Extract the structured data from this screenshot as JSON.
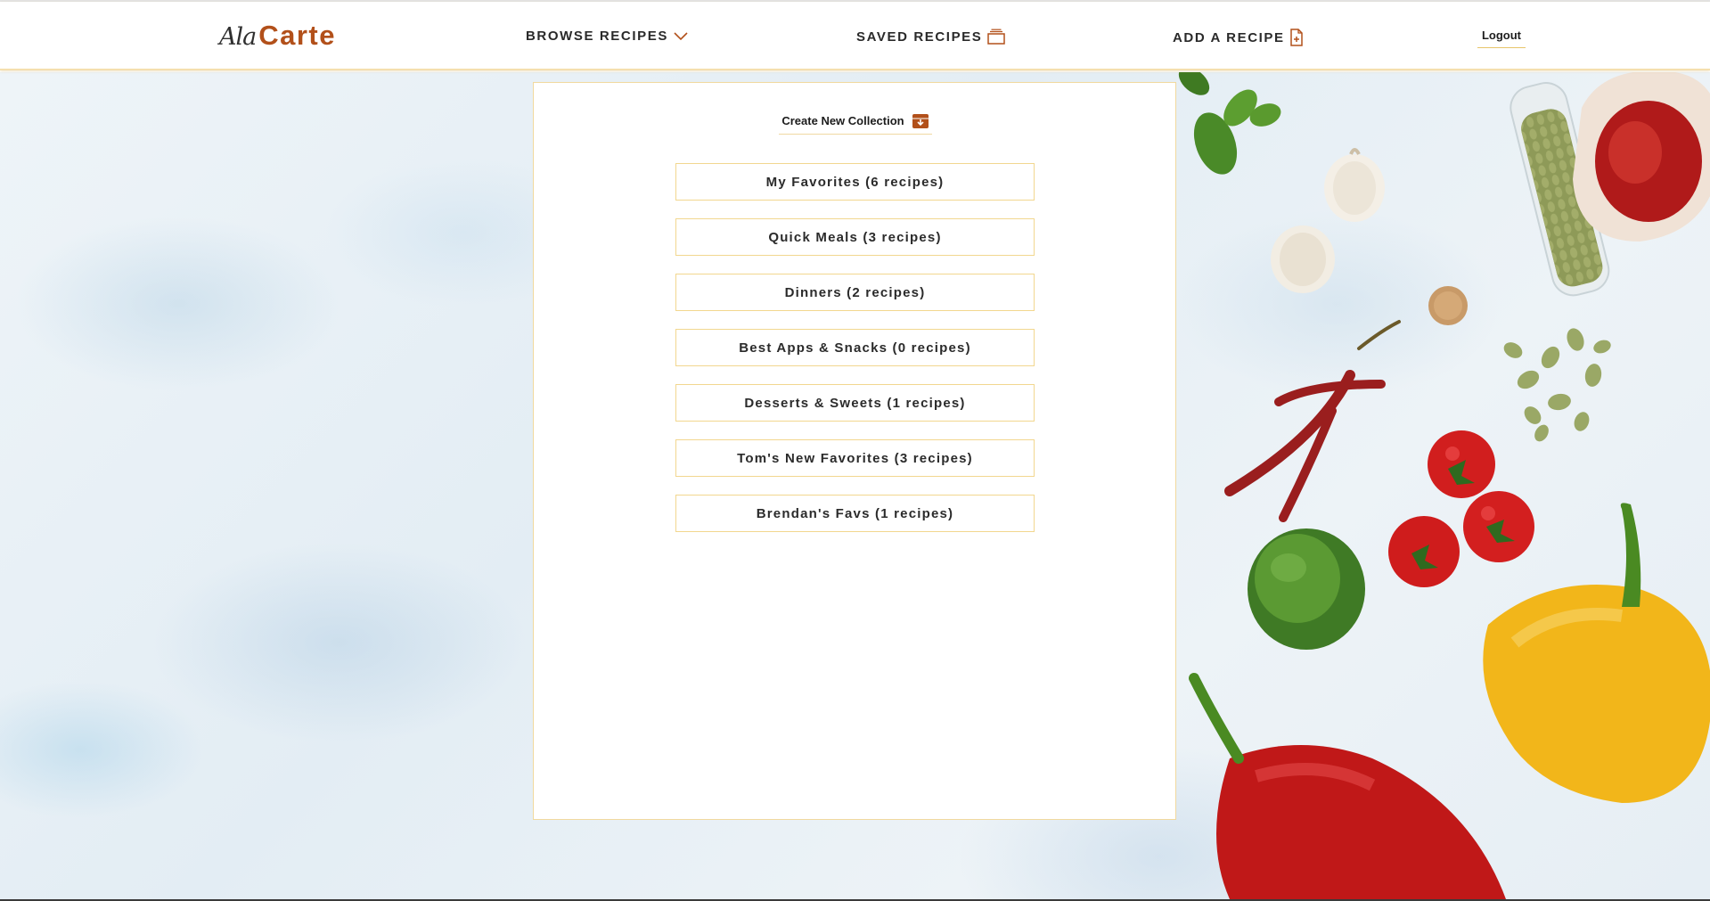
{
  "brand": {
    "script": "AlaCarte",
    "script_part": "Ala",
    "main_part": "Carte"
  },
  "nav": {
    "browse_label": "BROWSE RECIPES",
    "saved_label": "SAVED RECIPES",
    "add_label": "ADD A RECIPE",
    "logout_label": "Logout"
  },
  "collections": {
    "create_label": "Create New Collection",
    "items": [
      "My Favorites (6 recipes)",
      "Quick Meals (3 recipes)",
      "Dinners (2 recipes)",
      "Best Apps & Snacks (0 recipes)",
      "Desserts & Sweets (1 recipes)",
      "Tom's New Favorites (3 recipes)",
      "Brendan's Favs (1 recipes)"
    ]
  },
  "colors": {
    "brand_accent": "#b2501a",
    "gold_border": "#f2d78f",
    "text": "#2b2b2b"
  },
  "icons": {
    "browse": "chevron-down-icon",
    "saved": "recipe-box-icon",
    "add": "add-document-icon",
    "create": "box-download-icon"
  }
}
